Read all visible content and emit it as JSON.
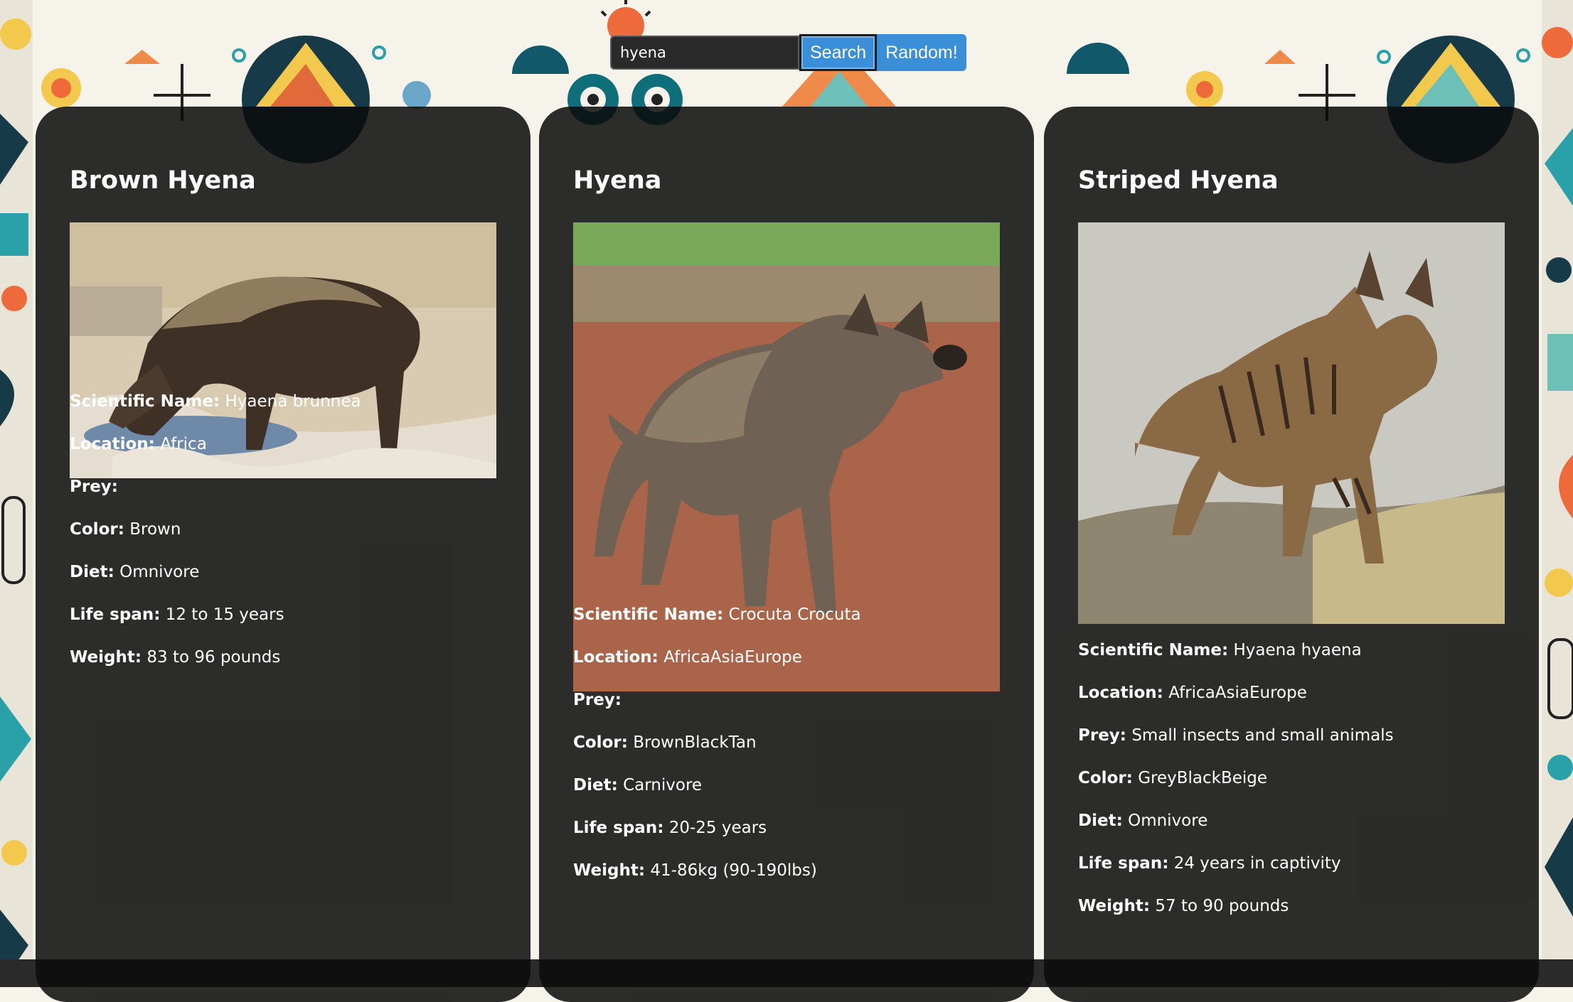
{
  "search": {
    "value": "hyena",
    "search_label": "Search",
    "random_label": "Random!"
  },
  "cards": [
    {
      "title": "Brown Hyena",
      "facts": [
        {
          "label": "Scientific Name:",
          "value": "Hyaena brunnea"
        },
        {
          "label": "Location:",
          "value": "Africa"
        },
        {
          "label": "Prey:",
          "value": ""
        },
        {
          "label": "Color:",
          "value": "Brown"
        },
        {
          "label": "Diet:",
          "value": "Omnivore"
        },
        {
          "label": "Life span:",
          "value": "12 to 15 years"
        },
        {
          "label": "Weight:",
          "value": "83 to 96 pounds"
        }
      ]
    },
    {
      "title": "Hyena",
      "facts": [
        {
          "label": "Scientific Name:",
          "value": "Crocuta Crocuta"
        },
        {
          "label": "Location:",
          "value": "AfricaAsiaEurope"
        },
        {
          "label": "Prey:",
          "value": ""
        },
        {
          "label": "Color:",
          "value": "BrownBlackTan"
        },
        {
          "label": "Diet:",
          "value": "Carnivore"
        },
        {
          "label": "Life span:",
          "value": "20-25 years"
        },
        {
          "label": "Weight:",
          "value": "41-86kg (90-190lbs)"
        }
      ]
    },
    {
      "title": "Striped Hyena",
      "facts": [
        {
          "label": "Scientific Name:",
          "value": "Hyaena hyaena"
        },
        {
          "label": "Location:",
          "value": "AfricaAsiaEurope"
        },
        {
          "label": "Prey:",
          "value": "Small insects and small animals"
        },
        {
          "label": "Color:",
          "value": "GreyBlackBeige"
        },
        {
          "label": "Diet:",
          "value": "Omnivore"
        },
        {
          "label": "Life span:",
          "value": "24 years in captivity"
        },
        {
          "label": "Weight:",
          "value": "57 to 90 pounds"
        }
      ]
    }
  ]
}
